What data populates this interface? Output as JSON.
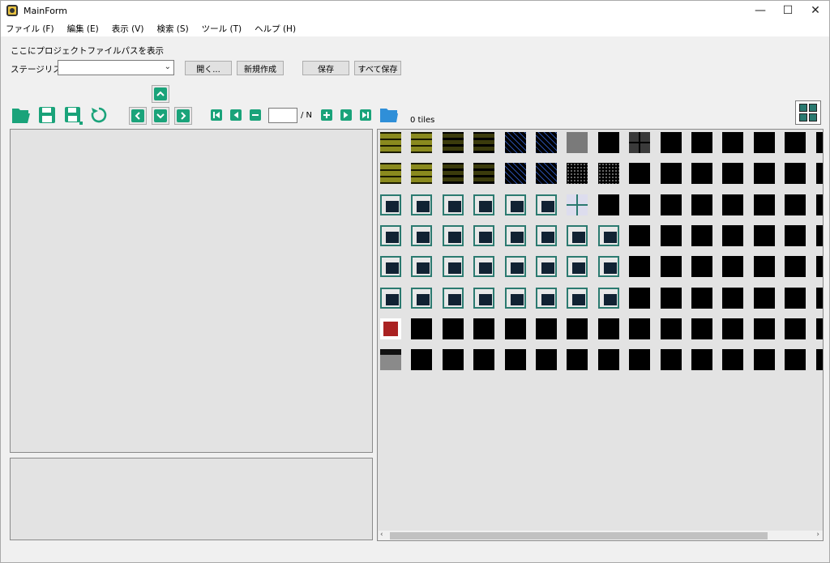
{
  "window": {
    "title": "MainForm",
    "minimize": "—",
    "maximize": "☐",
    "close": "✕"
  },
  "menu": [
    "ファイル (F)",
    "編集 (E)",
    "表示 (V)",
    "検索 (S)",
    "ツール (T)",
    "ヘルプ (H)"
  ],
  "project": {
    "path_label": "ここにプロジェクトファイルパスを表示"
  },
  "stage": {
    "label": "ステージリスト",
    "value": ""
  },
  "buttons": {
    "open": "開く...",
    "new": "新規作成",
    "save": "保存",
    "save_all": "すべて保存"
  },
  "pager": {
    "page_value": "",
    "total": "/ N"
  },
  "tiles": {
    "count_label": "0 tiles"
  },
  "colors": {
    "accent": "#1aa37a",
    "folder": "#2f8fd8"
  },
  "tile_grid": {
    "columns": 15,
    "rows": 8,
    "cells": [
      "brick",
      "brick",
      "brickd",
      "brickd",
      "mesh",
      "mesh",
      "gray",
      "black",
      "grid",
      "black",
      "black",
      "black",
      "black",
      "black",
      "black",
      "brick",
      "brick",
      "brickd",
      "brickd",
      "mesh",
      "mesh",
      "speck",
      "speck",
      "black",
      "black",
      "black",
      "black",
      "black",
      "black",
      "black",
      "panel",
      "panel",
      "panel",
      "panel",
      "panel",
      "panel",
      "window",
      "black",
      "black",
      "black",
      "black",
      "black",
      "black",
      "black",
      "black",
      "panel",
      "panel",
      "panel",
      "panel",
      "panel",
      "panel",
      "panel",
      "panel",
      "black",
      "black",
      "black",
      "black",
      "black",
      "black",
      "black",
      "panel",
      "panel",
      "panel",
      "panel",
      "panel",
      "panel",
      "panel",
      "panel",
      "black",
      "black",
      "black",
      "black",
      "black",
      "black",
      "black",
      "panel",
      "panel",
      "panel",
      "panel",
      "panel",
      "panel",
      "panel",
      "panel",
      "black",
      "black",
      "black",
      "black",
      "black",
      "black",
      "black",
      "red",
      "black",
      "black",
      "black",
      "black",
      "black",
      "black",
      "black",
      "black",
      "black",
      "black",
      "black",
      "black",
      "black",
      "black",
      "graybar",
      "black",
      "black",
      "black",
      "black",
      "black",
      "black",
      "black",
      "black",
      "black",
      "black",
      "black",
      "black",
      "black",
      "black"
    ]
  }
}
